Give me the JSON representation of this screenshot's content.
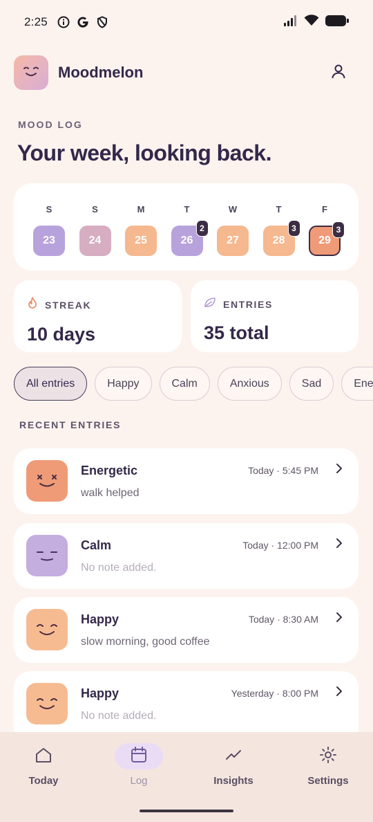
{
  "status_bar": {
    "time": "2:25",
    "icons": [
      "info-icon",
      "google-icon",
      "shield-icon",
      "signal-icon",
      "wifi-icon",
      "battery-icon"
    ]
  },
  "header": {
    "app_name": "Moodmelon",
    "logo_icon": "smile-face-icon",
    "profile_icon": "person-icon"
  },
  "page": {
    "eyebrow": "MOOD LOG",
    "title": "Your week, looking back."
  },
  "week": [
    {
      "letter": "S",
      "date": "23",
      "color": "#b8a2dc",
      "badge": null
    },
    {
      "letter": "S",
      "date": "24",
      "color": "#d7adc2",
      "badge": null
    },
    {
      "letter": "M",
      "date": "25",
      "color": "#f5b88f",
      "badge": null
    },
    {
      "letter": "T",
      "date": "26",
      "color": "#b8a2dc",
      "badge": "2"
    },
    {
      "letter": "W",
      "date": "27",
      "color": "#f5b88f",
      "badge": null
    },
    {
      "letter": "T",
      "date": "28",
      "color": "#f5b88f",
      "badge": "3"
    },
    {
      "letter": "F",
      "date": "29",
      "color": "#ef9b78",
      "badge": "3",
      "selected": true
    }
  ],
  "stats": {
    "streak_label": "STREAK",
    "streak_value": "10 days",
    "entries_label": "ENTRIES",
    "entries_value": "35 total"
  },
  "filters": [
    "All entries",
    "Happy",
    "Calm",
    "Anxious",
    "Sad",
    "Energetic"
  ],
  "active_filter": "All entries",
  "recent": {
    "label": "RECENT ENTRIES",
    "entries": [
      {
        "mood": "Energetic",
        "time": "Today · 5:45 PM",
        "note": "walk helped",
        "face": "energetic-face-icon",
        "color": "#ef9b78"
      },
      {
        "mood": "Calm",
        "time": "Today · 12:00 PM",
        "note": "No note added.",
        "face": "calm-face-icon",
        "color": "#c4addf"
      },
      {
        "mood": "Happy",
        "time": "Today · 8:30 AM",
        "note": "slow morning, good coffee",
        "face": "happy-face-icon",
        "color": "#f6bb91"
      },
      {
        "mood": "Happy",
        "time": "Yesterday · 8:00 PM",
        "note": "No note added.",
        "face": "happy-face-icon",
        "color": "#f6bb91"
      }
    ]
  },
  "nav": {
    "items": [
      {
        "label": "Today",
        "icon": "home-icon"
      },
      {
        "label": "Log",
        "icon": "calendar-icon",
        "active": true
      },
      {
        "label": "Insights",
        "icon": "trend-icon"
      },
      {
        "label": "Settings",
        "icon": "gear-icon"
      }
    ]
  }
}
